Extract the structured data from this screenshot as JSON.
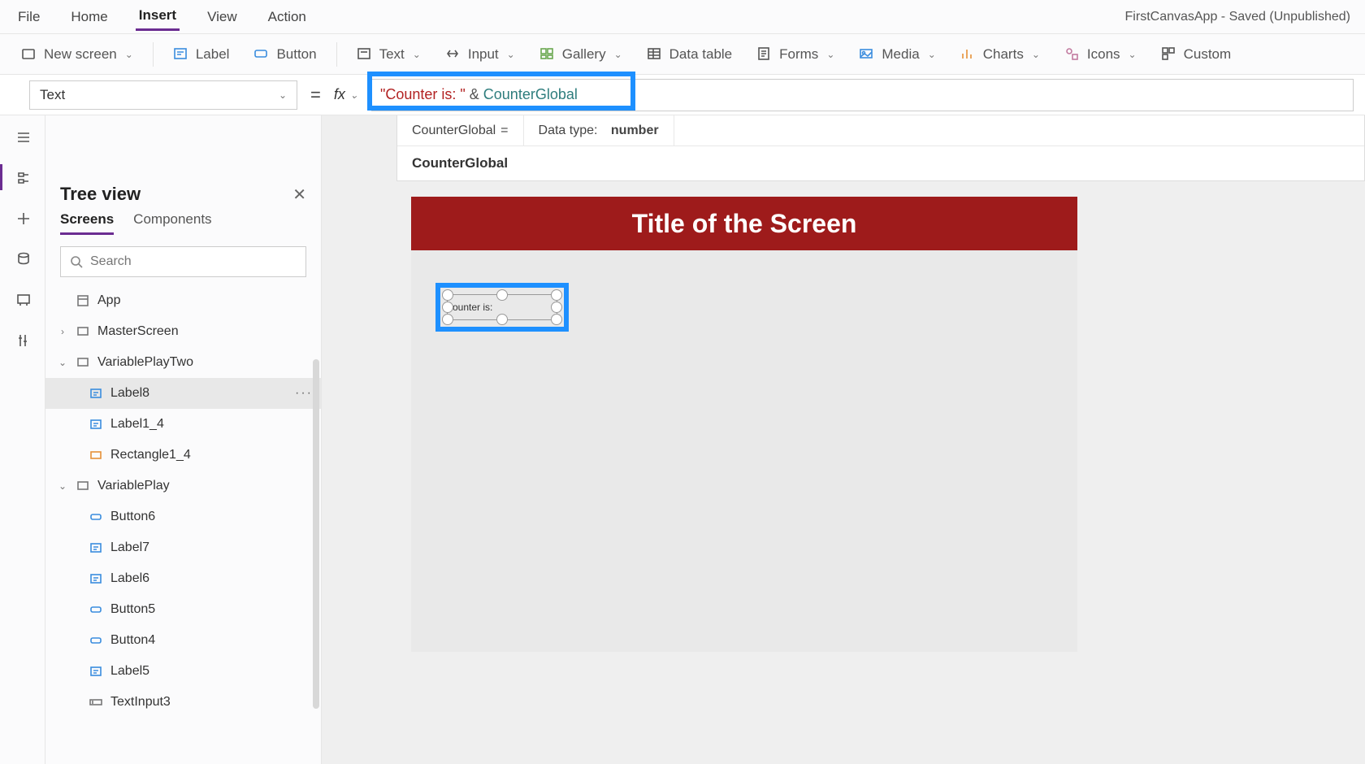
{
  "app_title": "FirstCanvasApp - Saved (Unpublished)",
  "menubar": [
    "File",
    "Home",
    "Insert",
    "View",
    "Action"
  ],
  "menubar_active": "Insert",
  "ribbon": {
    "new_screen": "New screen",
    "label": "Label",
    "button": "Button",
    "text": "Text",
    "input": "Input",
    "gallery": "Gallery",
    "data_table": "Data table",
    "forms": "Forms",
    "media": "Media",
    "charts": "Charts",
    "icons": "Icons",
    "custom": "Custom"
  },
  "property_selected": "Text",
  "formula": {
    "string": "\"Counter is: \"",
    "op": " & ",
    "var": "CounterGlobal"
  },
  "intel": {
    "var_name": "CounterGlobal",
    "eq": " = ",
    "data_type_label": "Data type:",
    "data_type_value": "number",
    "suggestion": "CounterGlobal"
  },
  "tree": {
    "title": "Tree view",
    "tabs": [
      "Screens",
      "Components"
    ],
    "tabs_active": "Screens",
    "search_placeholder": "Search",
    "nodes": [
      {
        "label": "App",
        "depth": 0,
        "icon": "app",
        "exp": ""
      },
      {
        "label": "MasterScreen",
        "depth": 0,
        "icon": "screen",
        "exp": "›"
      },
      {
        "label": "VariablePlayTwo",
        "depth": 0,
        "icon": "screen",
        "exp": "⌄"
      },
      {
        "label": "Label8",
        "depth": 1,
        "icon": "label",
        "exp": "",
        "sel": true,
        "more": true
      },
      {
        "label": "Label1_4",
        "depth": 1,
        "icon": "label",
        "exp": ""
      },
      {
        "label": "Rectangle1_4",
        "depth": 1,
        "icon": "rect",
        "exp": ""
      },
      {
        "label": "VariablePlay",
        "depth": 0,
        "icon": "screen",
        "exp": "⌄"
      },
      {
        "label": "Button6",
        "depth": 1,
        "icon": "button",
        "exp": ""
      },
      {
        "label": "Label7",
        "depth": 1,
        "icon": "label",
        "exp": ""
      },
      {
        "label": "Label6",
        "depth": 1,
        "icon": "label",
        "exp": ""
      },
      {
        "label": "Button5",
        "depth": 1,
        "icon": "button",
        "exp": ""
      },
      {
        "label": "Button4",
        "depth": 1,
        "icon": "button",
        "exp": ""
      },
      {
        "label": "Label5",
        "depth": 1,
        "icon": "label",
        "exp": ""
      },
      {
        "label": "TextInput3",
        "depth": 1,
        "icon": "textinput",
        "exp": ""
      }
    ]
  },
  "canvas": {
    "screen_title": "Title of the Screen",
    "selected_label_text": "ounter is:"
  }
}
